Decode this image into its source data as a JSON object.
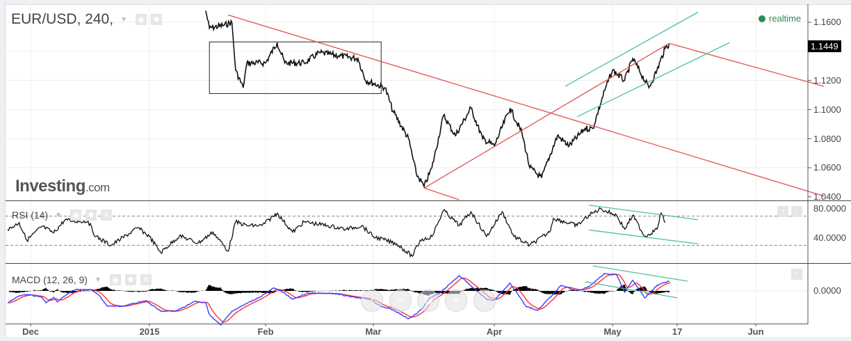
{
  "header": {
    "symbol_title": "EUR/USD, 240,",
    "realtime_label": "realtime",
    "logo_text": "Investing",
    "logo_suffix": ".com"
  },
  "price_axis": {
    "ticks": [
      "1.1600",
      "1.1200",
      "1.1000",
      "1.0800",
      "1.0600",
      "1.0400"
    ],
    "last_price": "1.1449"
  },
  "rsi": {
    "title": "RSI (14)",
    "ticks": [
      "80.0000",
      "40.0000"
    ],
    "levels": [
      70,
      30
    ]
  },
  "macd": {
    "title": "MACD (12, 26, 9)",
    "ticks": [
      "0.0000"
    ]
  },
  "x_axis": {
    "ticks": [
      "Dec",
      "2015",
      "Feb",
      "Mar",
      "Apr",
      "May",
      "17",
      "Jun"
    ]
  },
  "colors": {
    "price": "#111111",
    "trend_red": "#e05050",
    "channel_teal": "#4fbfa0",
    "macd_line": "#3a3aff",
    "signal_line": "#ff3030",
    "realtime": "#2e8b57",
    "histogram": "#000000"
  },
  "icons": {
    "pane_buttons": [
      "eye-icon",
      "gear-icon",
      "close-icon"
    ],
    "nav_buttons": [
      "scroll-left-icon",
      "zoom-out-icon",
      "reset-icon",
      "zoom-in-icon",
      "scroll-right-icon"
    ]
  },
  "chart_data": {
    "type": "line",
    "price": {
      "name": "EUR/USD",
      "ylim": [
        1.04,
        1.17
      ],
      "points": [
        [
          "2015-01-16",
          1.168
        ],
        [
          "2015-01-17",
          1.156
        ],
        [
          "2015-01-21",
          1.158
        ],
        [
          "2015-01-23",
          1.16
        ],
        [
          "2015-01-24",
          1.127
        ],
        [
          "2015-01-26",
          1.115
        ],
        [
          "2015-01-27",
          1.132
        ],
        [
          "2015-02-01",
          1.132
        ],
        [
          "2015-02-04",
          1.146
        ],
        [
          "2015-02-06",
          1.132
        ],
        [
          "2015-02-11",
          1.132
        ],
        [
          "2015-02-15",
          1.139
        ],
        [
          "2015-02-20",
          1.137
        ],
        [
          "2015-02-25",
          1.135
        ],
        [
          "2015-02-27",
          1.12
        ],
        [
          "2015-03-04",
          1.115
        ],
        [
          "2015-03-06",
          1.099
        ],
        [
          "2015-03-10",
          1.08
        ],
        [
          "2015-03-12",
          1.056
        ],
        [
          "2015-03-14",
          1.047
        ],
        [
          "2015-03-16",
          1.06
        ],
        [
          "2015-03-19",
          1.096
        ],
        [
          "2015-03-22",
          1.082
        ],
        [
          "2015-03-26",
          1.101
        ],
        [
          "2015-03-29",
          1.08
        ],
        [
          "2015-04-01",
          1.075
        ],
        [
          "2015-04-05",
          1.101
        ],
        [
          "2015-04-08",
          1.084
        ],
        [
          "2015-04-10",
          1.06
        ],
        [
          "2015-04-13",
          1.053
        ],
        [
          "2015-04-17",
          1.082
        ],
        [
          "2015-04-20",
          1.075
        ],
        [
          "2015-04-24",
          1.087
        ],
        [
          "2015-04-26",
          1.087
        ],
        [
          "2015-04-29",
          1.113
        ],
        [
          "2015-05-01",
          1.127
        ],
        [
          "2015-05-04",
          1.12
        ],
        [
          "2015-05-06",
          1.135
        ],
        [
          "2015-05-10",
          1.115
        ],
        [
          "2015-05-12",
          1.127
        ],
        [
          "2015-05-14",
          1.142
        ],
        [
          "2015-05-15",
          1.1449
        ]
      ]
    },
    "drawings": {
      "rectangle": {
        "from": [
          "2015-01-17",
          1.1465
        ],
        "to": [
          "2015-03-03",
          1.111
        ]
      },
      "red_lines": [
        {
          "from": [
            "2015-01-22",
            1.165
          ],
          "to": [
            "2015-06-14",
            1.0405
          ]
        },
        {
          "from": [
            "2015-03-14",
            1.046
          ],
          "to": [
            "2015-03-23",
            1.038
          ]
        },
        {
          "from": [
            "2015-03-14",
            1.046
          ],
          "to": [
            "2015-05-15",
            1.1455
          ]
        },
        {
          "from": [
            "2015-05-15",
            1.1455
          ],
          "to": [
            "2015-06-14",
            1.116
          ]
        }
      ],
      "teal_lines": [
        {
          "from": [
            "2015-04-19",
            1.116
          ],
          "to": [
            "2015-05-21",
            1.167
          ]
        },
        {
          "from": [
            "2015-04-22",
            1.095
          ],
          "to": [
            "2015-05-27",
            1.146
          ]
        }
      ],
      "rsi_teal_lines": [
        {
          "from": [
            "2015-04-25",
            85
          ],
          "to": [
            "2015-05-21",
            65
          ]
        },
        {
          "from": [
            "2015-04-25",
            51
          ],
          "to": [
            "2015-05-21",
            32
          ]
        }
      ],
      "macd_teal_lines": [
        {
          "from": [
            "2015-04-26",
            0.009
          ],
          "to": [
            "2015-05-19",
            0.0035
          ]
        },
        {
          "from": [
            "2015-04-24",
            0.0033
          ],
          "to": [
            "2015-05-17",
            -0.0025
          ]
        }
      ]
    },
    "rsi_series": {
      "ylim": [
        10,
        90
      ],
      "points": [
        [
          "2014-11-25",
          51
        ],
        [
          "2014-11-28",
          61
        ],
        [
          "2014-11-30",
          37
        ],
        [
          "2014-12-04",
          56
        ],
        [
          "2014-12-07",
          47
        ],
        [
          "2014-12-10",
          65
        ],
        [
          "2014-12-12",
          63
        ],
        [
          "2014-12-16",
          63
        ],
        [
          "2014-12-18",
          42
        ],
        [
          "2014-12-22",
          30
        ],
        [
          "2014-12-29",
          54
        ],
        [
          "2015-01-01",
          42
        ],
        [
          "2015-01-04",
          20
        ],
        [
          "2015-01-09",
          43
        ],
        [
          "2015-01-14",
          33
        ],
        [
          "2015-01-18",
          48
        ],
        [
          "2015-01-22",
          22
        ],
        [
          "2015-01-24",
          62
        ],
        [
          "2015-01-27",
          57
        ],
        [
          "2015-01-31",
          57
        ],
        [
          "2015-02-04",
          74
        ],
        [
          "2015-02-08",
          48
        ],
        [
          "2015-02-11",
          62
        ],
        [
          "2015-02-17",
          57
        ],
        [
          "2015-02-22",
          52
        ],
        [
          "2015-02-26",
          57
        ],
        [
          "2015-03-01",
          42
        ],
        [
          "2015-03-07",
          32
        ],
        [
          "2015-03-11",
          15
        ],
        [
          "2015-03-13",
          37
        ],
        [
          "2015-03-16",
          42
        ],
        [
          "2015-03-19",
          78
        ],
        [
          "2015-03-23",
          57
        ],
        [
          "2015-03-26",
          76
        ],
        [
          "2015-03-30",
          42
        ],
        [
          "2015-04-03",
          76
        ],
        [
          "2015-04-06",
          42
        ],
        [
          "2015-04-10",
          30
        ],
        [
          "2015-04-15",
          48
        ],
        [
          "2015-04-16",
          67
        ],
        [
          "2015-04-22",
          57
        ],
        [
          "2015-04-25",
          71
        ],
        [
          "2015-04-28",
          80
        ],
        [
          "2015-05-02",
          71
        ],
        [
          "2015-05-04",
          52
        ],
        [
          "2015-05-06",
          71
        ],
        [
          "2015-05-09",
          42
        ],
        [
          "2015-05-12",
          52
        ],
        [
          "2015-05-13",
          74
        ],
        [
          "2015-05-14",
          61
        ]
      ]
    },
    "macd_series": {
      "points": [
        [
          "2014-11-25",
          -0.0043
        ],
        [
          "2014-11-28",
          -0.0018
        ],
        [
          "2014-11-30",
          -0.0013
        ],
        [
          "2014-12-04",
          -0.0023
        ],
        [
          "2014-12-05",
          -0.0043
        ],
        [
          "2014-12-07",
          -0.0023
        ],
        [
          "2014-12-08",
          -0.004
        ],
        [
          "2014-12-11",
          -0.0005
        ],
        [
          "2014-12-13",
          0.0005
        ],
        [
          "2014-12-17",
          0.0003
        ],
        [
          "2014-12-19",
          -0.0018
        ],
        [
          "2014-12-21",
          -0.0055
        ],
        [
          "2014-12-25",
          -0.0055
        ],
        [
          "2014-12-31",
          -0.0035
        ],
        [
          "2015-01-04",
          -0.0073
        ],
        [
          "2015-01-08",
          -0.0073
        ],
        [
          "2015-01-13",
          -0.0038
        ],
        [
          "2015-01-16",
          -0.0043
        ],
        [
          "2015-01-17",
          -0.0085
        ],
        [
          "2015-01-20",
          -0.0123
        ],
        [
          "2015-01-23",
          -0.0073
        ],
        [
          "2015-01-27",
          -0.0045
        ],
        [
          "2015-01-31",
          -0.0018
        ],
        [
          "2015-02-03",
          0.001
        ],
        [
          "2015-02-05",
          0.0
        ],
        [
          "2015-02-08",
          -0.003
        ],
        [
          "2015-02-12",
          -0.0008
        ],
        [
          "2015-02-19",
          -0.001
        ],
        [
          "2015-02-22",
          -0.0018
        ],
        [
          "2015-02-28",
          -0.003
        ],
        [
          "2015-03-03",
          -0.0055
        ],
        [
          "2015-03-06",
          -0.0068
        ],
        [
          "2015-03-10",
          -0.01
        ],
        [
          "2015-03-12",
          -0.0083
        ],
        [
          "2015-03-14",
          -0.0055
        ],
        [
          "2015-03-15",
          -0.003
        ],
        [
          "2015-03-18",
          -0.0008
        ],
        [
          "2015-03-23",
          0.0055
        ],
        [
          "2015-03-30",
          -0.003
        ],
        [
          "2015-04-01",
          -0.0033
        ],
        [
          "2015-04-05",
          0.0028
        ],
        [
          "2015-04-09",
          -0.0055
        ],
        [
          "2015-04-12",
          -0.007
        ],
        [
          "2015-04-16",
          -0.001
        ],
        [
          "2015-04-18",
          0.002
        ],
        [
          "2015-04-22",
          0.0
        ],
        [
          "2015-04-25",
          0.0015
        ],
        [
          "2015-04-29",
          0.0063
        ],
        [
          "2015-05-02",
          0.0058
        ],
        [
          "2015-05-04",
          -0.0005
        ],
        [
          "2015-05-06",
          0.0038
        ],
        [
          "2015-05-09",
          -0.0025
        ],
        [
          "2015-05-12",
          0.002
        ],
        [
          "2015-05-15",
          0.0035
        ]
      ]
    }
  }
}
